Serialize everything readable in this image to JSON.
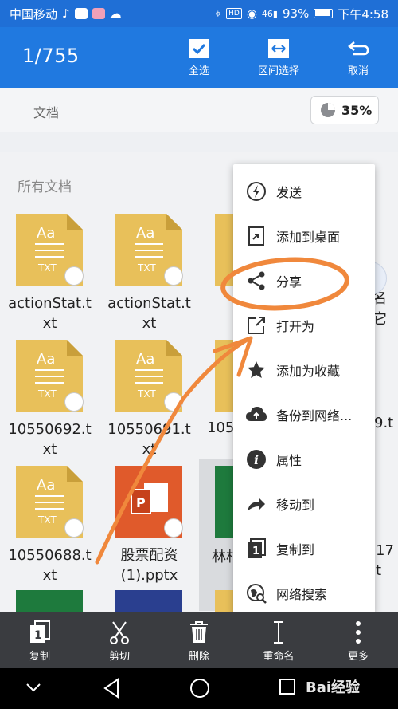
{
  "status_bar": {
    "carrier": "中国移动",
    "signal_text": "46",
    "battery": "93%",
    "time": "下午4:58"
  },
  "toolbar": {
    "count": "1/755",
    "select_all": "全选",
    "range_select": "区间选择",
    "cancel": "取消"
  },
  "storage": {
    "label": "文档",
    "percent": "35%"
  },
  "section_title": "所有文档",
  "files": [
    {
      "name_line1": "actionStat.t",
      "name_line2": "xt",
      "kind": "txt"
    },
    {
      "name_line1": "actionStat.t",
      "name_line2": "xt",
      "kind": "txt"
    },
    {
      "name_line1": "10550692.t",
      "name_line2": "xt",
      "kind": "txt"
    },
    {
      "name_line1": "10550691.t",
      "name_line2": "xt",
      "kind": "txt"
    },
    {
      "name_line1": "10550688.t",
      "name_line2": "xt",
      "kind": "txt"
    },
    {
      "name_line1": "股票配资",
      "name_line2": "(1).pptx",
      "kind": "pptx"
    }
  ],
  "partial_labels": {
    "row2_col3": "105",
    "row3_col3": "林村",
    "right_col1": "名",
    "right_col1b": "它",
    "right_col2": "9.t",
    "right_col3a": "17",
    "right_col3b": "t"
  },
  "doc_icon_labels": {
    "aa": "Aa",
    "txt": "TXT"
  },
  "menu": [
    {
      "label": "发送",
      "icon": "send-icon"
    },
    {
      "label": "添加到桌面",
      "icon": "add-to-desktop-icon"
    },
    {
      "label": "分享",
      "icon": "share-icon"
    },
    {
      "label": "打开为",
      "icon": "open-as-icon"
    },
    {
      "label": "添加为收藏",
      "icon": "star-icon"
    },
    {
      "label": "备份到网络...",
      "icon": "cloud-upload-icon"
    },
    {
      "label": "属性",
      "icon": "info-icon"
    },
    {
      "label": "移动到",
      "icon": "move-icon"
    },
    {
      "label": "复制到",
      "icon": "copy-to-icon"
    },
    {
      "label": "网络搜索",
      "icon": "web-search-icon"
    }
  ],
  "bottom_bar": {
    "copy": "复制",
    "cut": "剪切",
    "delete": "删除",
    "rename": "重命名",
    "more": "更多"
  },
  "watermark": "Bai经验",
  "colors": {
    "toolbar": "#2079e0",
    "status_bar": "#1f6fd6",
    "txt_icon": "#e8c05a",
    "pptx_icon": "#e05a2b",
    "annotation": "#f0883c",
    "bottom_bar": "#3a3c40"
  }
}
